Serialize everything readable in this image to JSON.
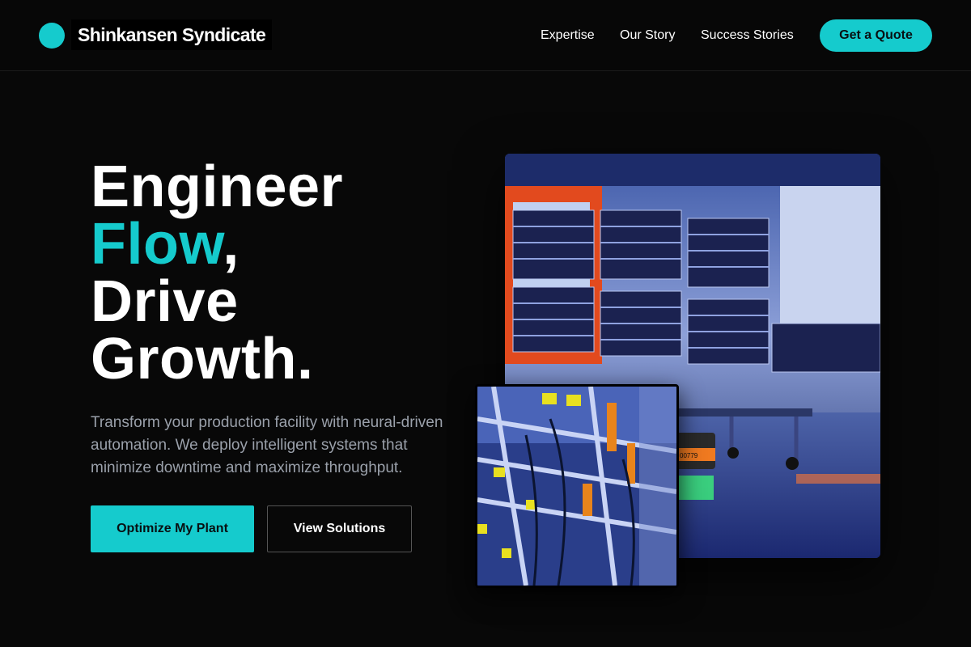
{
  "header": {
    "brand": "Shinkansen Syndicate",
    "nav": [
      "Expertise",
      "Our Story",
      "Success Stories"
    ],
    "cta_label": "Get a Quote"
  },
  "hero": {
    "headline_1": "Engineer",
    "headline_accent": "Flow",
    "headline_comma": ",",
    "headline_3": "Drive",
    "headline_4": "Growth.",
    "subtext": "Transform your production facility with neural-driven automation. We deploy intelligent systems that minimize downtime and maximize throughput.",
    "primary_button": "Optimize My Plant",
    "secondary_button": "View Solutions"
  },
  "images": {
    "main": "factory-server-racks-photo",
    "inset": "wiring-closeup-photo",
    "robot_label": "00779"
  },
  "colors": {
    "accent": "#15cbcd",
    "background": "#080808",
    "subtext": "#9aa0aa"
  }
}
